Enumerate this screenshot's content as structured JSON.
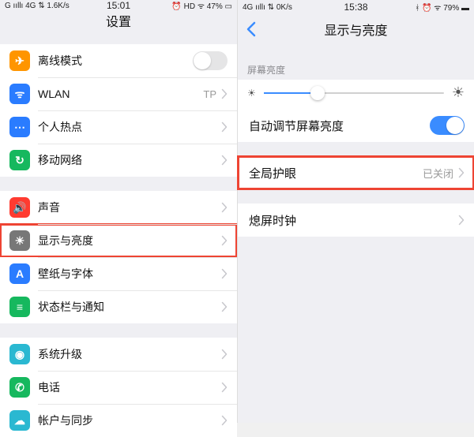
{
  "left": {
    "status": {
      "left": "G ııllı 4G ⇅ 1.6K/s",
      "time": "15:01",
      "right": "⏰ HD ᯤ 47% ▭"
    },
    "title": "设置",
    "groups": [
      [
        {
          "icon": "✈",
          "bg": "#ff9500",
          "label": "离线模式",
          "type": "toggle",
          "on": false
        },
        {
          "icon": "ᯤ",
          "bg": "#2a7cff",
          "label": "WLAN",
          "value": "TP",
          "type": "chevron"
        },
        {
          "icon": "⋯",
          "bg": "#2a7cff",
          "label": "个人热点",
          "type": "chevron"
        },
        {
          "icon": "↻",
          "bg": "#16b85e",
          "label": "移动网络",
          "type": "chevron"
        }
      ],
      [
        {
          "icon": "🔊",
          "bg": "#ff3b30",
          "label": "声音",
          "type": "chevron"
        },
        {
          "icon": "☀",
          "bg": "#777",
          "label": "显示与亮度",
          "type": "chevron",
          "highlight": true
        },
        {
          "icon": "A",
          "bg": "#2a7cff",
          "label": "壁纸与字体",
          "type": "chevron"
        },
        {
          "icon": "≡",
          "bg": "#16b85e",
          "label": "状态栏与通知",
          "type": "chevron"
        }
      ],
      [
        {
          "icon": "◉",
          "bg": "#2ab8d1",
          "label": "系统升级",
          "type": "chevron"
        },
        {
          "icon": "✆",
          "bg": "#16b85e",
          "label": "电话",
          "type": "chevron"
        },
        {
          "icon": "☁",
          "bg": "#2ab8d1",
          "label": "帐户与同步",
          "type": "chevron"
        }
      ]
    ]
  },
  "right": {
    "status": {
      "left": "4G ııllı ⇅ 0K/s",
      "time": "15:38",
      "right": "ᚼ ⏰ ᯤ 79% ▬"
    },
    "title": "显示与亮度",
    "section_label": "屏幕亮度",
    "slider": {
      "pct": 30,
      "low_icon": "☀",
      "high_icon": "☀"
    },
    "rows": [
      {
        "label": "自动调节屏幕亮度",
        "type": "toggle",
        "on": true
      },
      {
        "label": "全局护眼",
        "value": "已关闭",
        "type": "chevron",
        "highlight": true
      },
      {
        "label": "熄屏时钟",
        "type": "chevron"
      }
    ]
  }
}
